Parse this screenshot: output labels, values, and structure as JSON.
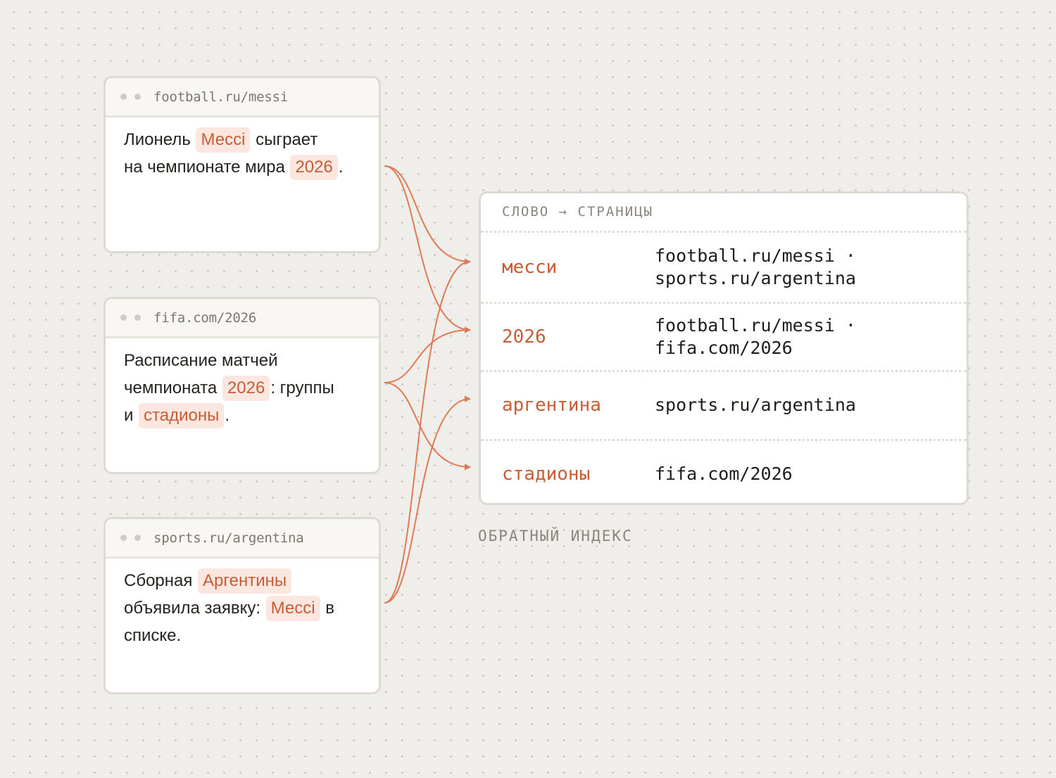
{
  "documents": [
    {
      "url": "football.ru/messi",
      "lines": [
        [
          {
            "t": "Лионель "
          },
          {
            "t": "Мессі",
            "hl": true
          },
          {
            "t": " сыграет"
          }
        ],
        [
          {
            "t": "на чемпионате мира "
          },
          {
            "t": "2026",
            "hl": true
          },
          {
            "t": "."
          }
        ]
      ]
    },
    {
      "url": "fifa.com/2026",
      "lines": [
        [
          {
            "t": "Расписание матчей"
          }
        ],
        [
          {
            "t": "чемпионата "
          },
          {
            "t": "2026",
            "hl": true
          },
          {
            "t": ": группы"
          }
        ],
        [
          {
            "t": "и "
          },
          {
            "t": "стадионы",
            "hl": true
          },
          {
            "t": "."
          }
        ]
      ]
    },
    {
      "url": "sports.ru/argentina",
      "lines": [
        [
          {
            "t": "Сборная "
          },
          {
            "t": "Аргентины",
            "hl": true
          }
        ],
        [
          {
            "t": "объявила заявку: "
          },
          {
            "t": "Мессі",
            "hl": true
          },
          {
            "t": " в"
          }
        ],
        [
          {
            "t": "списке."
          }
        ]
      ]
    }
  ],
  "index": {
    "header": "СЛОВО → СТРАНИЦЫ",
    "rows": [
      {
        "word": "месси",
        "pages": [
          "football.ru/messi ·",
          "sports.ru/argentina"
        ]
      },
      {
        "word": "2026",
        "pages": [
          "football.ru/messi ·",
          "fifa.com/2026"
        ]
      },
      {
        "word": "аргентина",
        "pages": [
          "sports.ru/argentina"
        ]
      },
      {
        "word": "стадионы",
        "pages": [
          "fifa.com/2026"
        ]
      }
    ]
  },
  "caption": "ОБРАТНЫЙ ИНДЕКС",
  "links": [
    {
      "from": 0,
      "to": 0
    },
    {
      "from": 0,
      "to": 1
    },
    {
      "from": 1,
      "to": 1
    },
    {
      "from": 1,
      "to": 3
    },
    {
      "from": 2,
      "to": 2
    },
    {
      "from": 2,
      "to": 0
    }
  ],
  "colors": {
    "accent": "#c75d36",
    "highlight_bg": "#fbe7df",
    "link": "#e07a55"
  }
}
